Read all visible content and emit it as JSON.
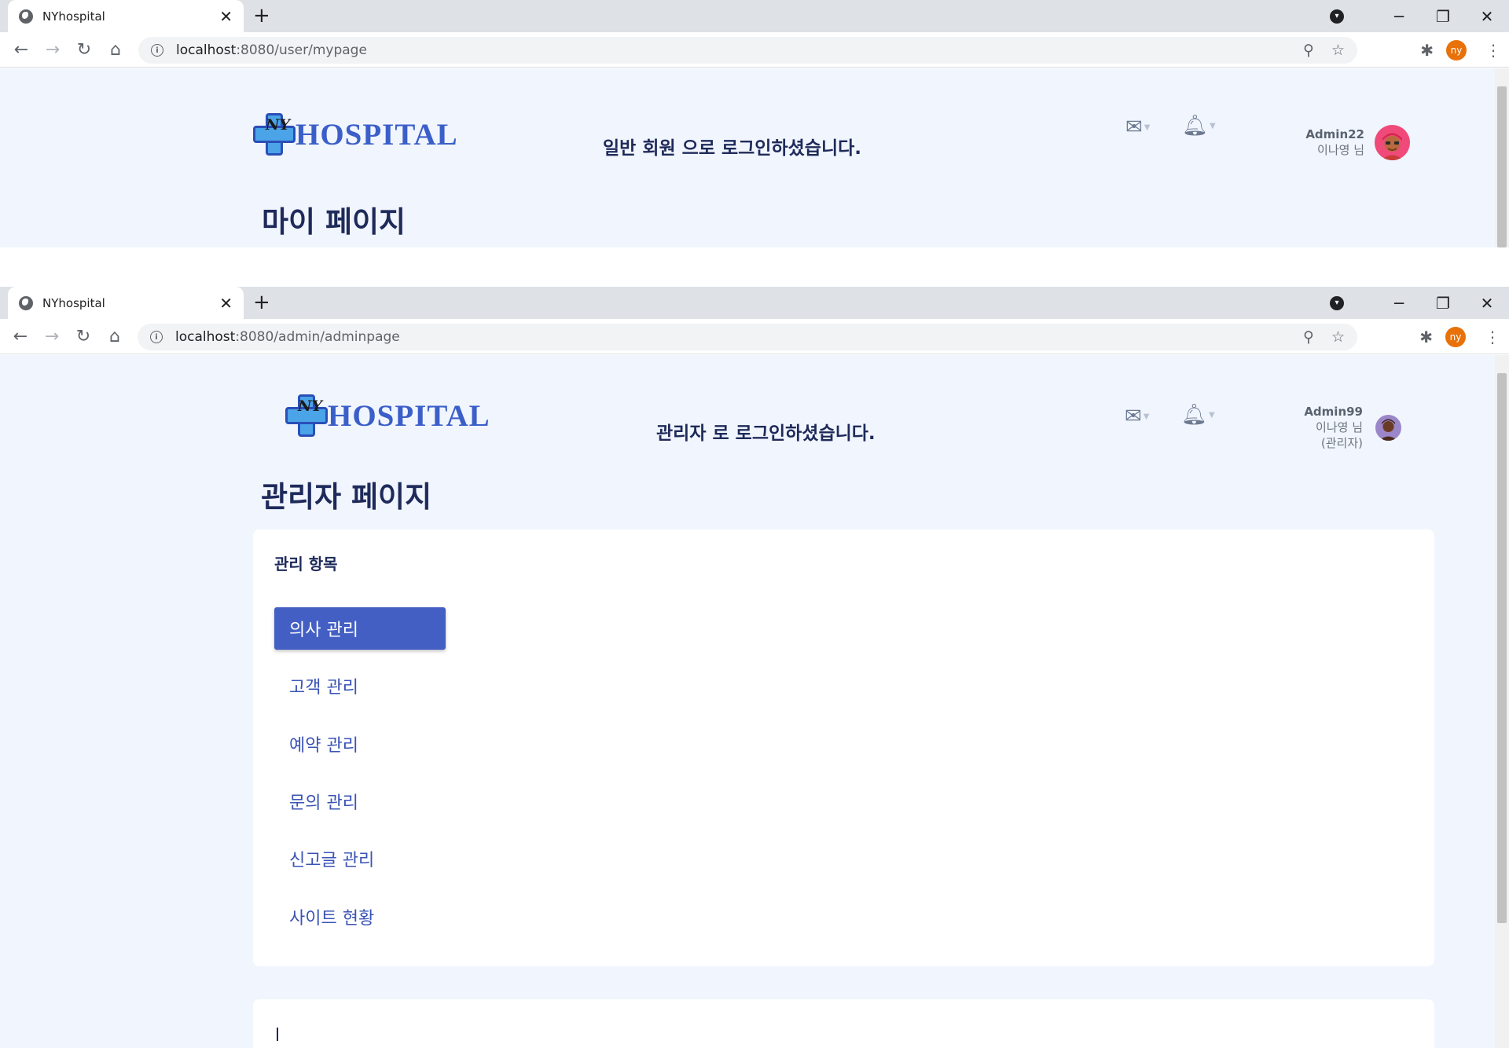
{
  "window1": {
    "tab_title": "NYhospital",
    "url_host": "localhost",
    "url_rest": ":8080/user/mypage",
    "logo_ny": "NY",
    "logo_text": "HOSPITAL",
    "login_message": "일반 회원 으로 로그인하셨습니다.",
    "user": {
      "username": "Admin22",
      "display_name": "이나영 님"
    },
    "page_title": "마이 페이지"
  },
  "window2": {
    "tab_title": "NYhospital",
    "url_host": "localhost",
    "url_rest": ":8080/admin/adminpage",
    "logo_ny": "NY",
    "logo_text": "HOSPITAL",
    "login_message": "관리자 로 로그인하셨습니다.",
    "user": {
      "username": "Admin99",
      "display_name": "이나영 님",
      "role": "(관리자)"
    },
    "page_title": "관리자 페이지",
    "panel": {
      "title": "관리 항목",
      "items": [
        {
          "label": "의사 관리",
          "active": true
        },
        {
          "label": "고객 관리",
          "active": false
        },
        {
          "label": "예약 관리",
          "active": false
        },
        {
          "label": "문의 관리",
          "active": false
        },
        {
          "label": "신고글 관리",
          "active": false
        },
        {
          "label": "사이트 현황",
          "active": false
        }
      ]
    }
  },
  "browser": {
    "profile_initials": "ny",
    "icons": [
      "globe-icon",
      "close-icon",
      "plus-icon",
      "tab-search-icon",
      "minimize-icon",
      "restore-icon",
      "window-close-icon",
      "back-icon",
      "forward-icon",
      "reload-icon",
      "home-icon",
      "info-icon",
      "zoom-icon",
      "star-icon",
      "extensions-icon",
      "kebab-menu-icon"
    ]
  },
  "header_icons": [
    "mail-icon",
    "bell-icon"
  ],
  "colors": {
    "page_bg": "#f1f5fd",
    "accent": "#445fc4",
    "title": "#1e2a5a",
    "logo_blue": "#3b5fc9"
  }
}
